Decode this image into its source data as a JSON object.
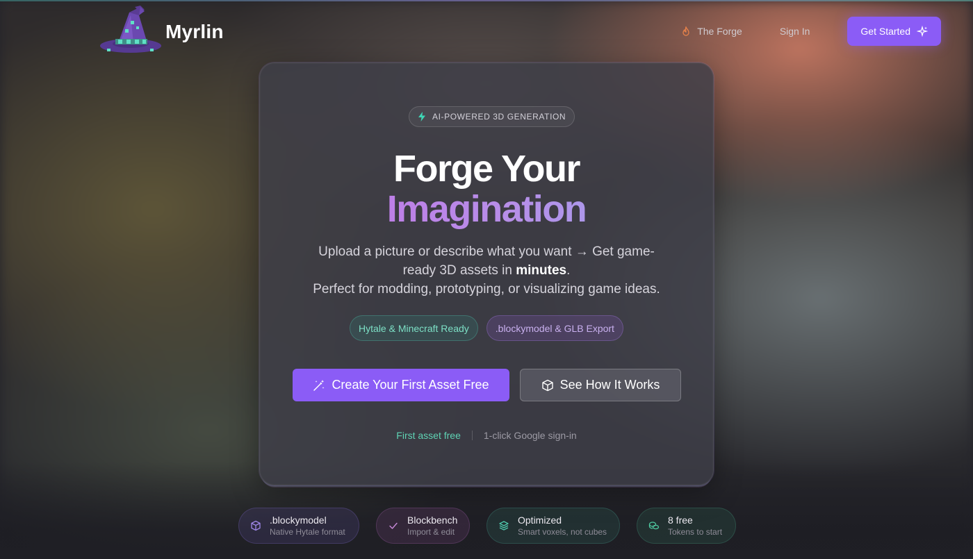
{
  "header": {
    "brand": "Myrlin",
    "nav": {
      "forge_label": "The Forge",
      "signin_label": "Sign In",
      "get_started_label": "Get Started"
    }
  },
  "hero": {
    "badge": "AI-POWERED 3D GENERATION",
    "headline_line1": "Forge Your",
    "headline_line2": "Imagination",
    "subtitle_part1": "Upload a picture or describe what you want → Get game-ready 3D assets in ",
    "subtitle_strong": "minutes",
    "subtitle_part2": ".",
    "subtitle_line2": "Perfect for modding, prototyping, or visualizing game ideas.",
    "tags": [
      "Hytale & Minecraft Ready",
      ".blockymodel & GLB Export"
    ],
    "primary_cta": "Create Your First Asset Free",
    "secondary_cta": "See How It Works",
    "footnote_left": "First asset free",
    "footnote_right": "1-click Google sign-in"
  },
  "features": [
    {
      "title": ".blockymodel",
      "subtitle": "Native Hytale format",
      "icon": "cube-icon"
    },
    {
      "title": "Blockbench",
      "subtitle": "Import & edit",
      "icon": "check-icon"
    },
    {
      "title": "Optimized",
      "subtitle": "Smart voxels, not cubes",
      "icon": "layers-icon"
    },
    {
      "title": "8 free",
      "subtitle": "Tokens to start",
      "icon": "coins-icon"
    }
  ],
  "colors": {
    "accent": "#8b5cf6",
    "teal": "#5fd3b4",
    "gradient_start": "#c470e6",
    "gradient_end": "#9da6ee"
  }
}
